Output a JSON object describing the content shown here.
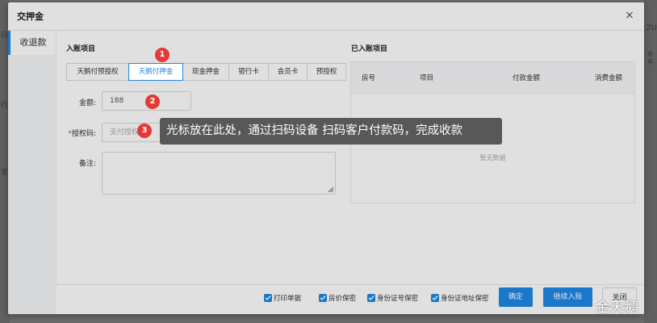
{
  "background": {
    "left_texts": [
      "日",
      "行",
      "定"
    ],
    "right_texts": [
      "ZU",
      "余号"
    ]
  },
  "modal": {
    "title": "交押金",
    "close_symbol": "×"
  },
  "sidenav": {
    "items": [
      {
        "label": "收退款"
      }
    ]
  },
  "sections": {
    "left_title": "入账项目",
    "right_title": "已入账项目"
  },
  "tabs": [
    {
      "label": "天鹅付预授权",
      "active": false
    },
    {
      "label": "天鹅付押金",
      "active": true
    },
    {
      "label": "现金押金",
      "active": false
    },
    {
      "label": "银行卡",
      "active": false
    },
    {
      "label": "会员卡",
      "active": false
    },
    {
      "label": "预授权",
      "active": false
    }
  ],
  "form": {
    "amount_label": "金额:",
    "amount_value": "188",
    "auth_label": "授权码:",
    "auth_placeholder": "支付授权码",
    "remark_label": "备注:"
  },
  "table": {
    "headers": [
      "房号",
      "项目",
      "付款金额",
      "消费金额"
    ],
    "empty_text": "暂无数据"
  },
  "footer": {
    "checkboxes": [
      {
        "label": "打印单据",
        "checked": true
      },
      {
        "label": "房价保密",
        "checked": true
      },
      {
        "label": "身份证号保密",
        "checked": true
      },
      {
        "label": "身份证地址保密",
        "checked": true
      }
    ],
    "confirm_label": "确定",
    "continue_label": "继续入账",
    "close_label": "关闭"
  },
  "annotations": {
    "markers": [
      "1",
      "2",
      "3"
    ],
    "tooltip": "光标放在此处，通过扫码设备 扫码客户付款码，完成收款"
  },
  "watermark": "金天鹅",
  "colors": {
    "accent": "#1e88e5",
    "marker": "#e53935",
    "tooltip_bg": "#585858"
  }
}
